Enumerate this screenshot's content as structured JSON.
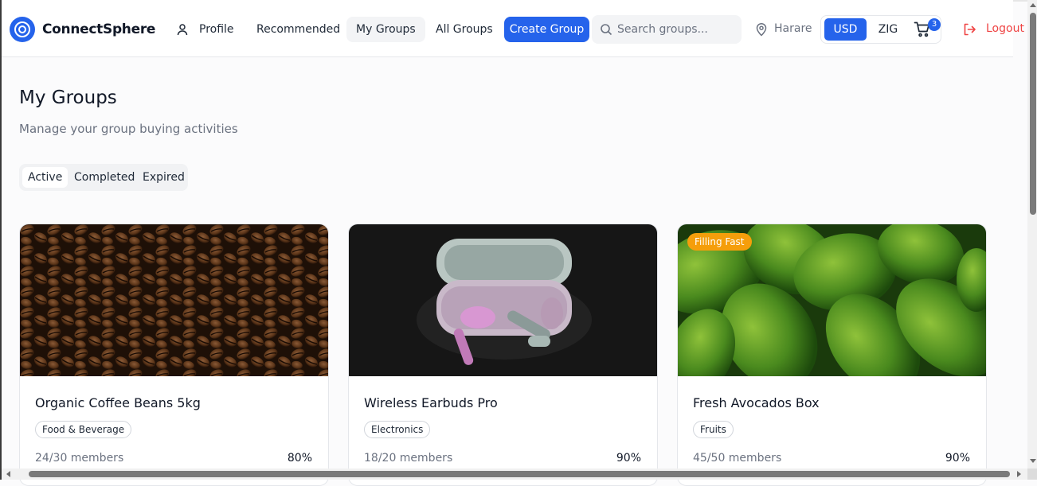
{
  "app": {
    "brand": "ConnectSphere"
  },
  "nav": {
    "profile": "Profile",
    "recommended": "Recommended",
    "my_groups": "My Groups",
    "all_groups": "All Groups",
    "create_group": "Create Group"
  },
  "search": {
    "placeholder": "Search groups..."
  },
  "location": {
    "city": "Harare"
  },
  "currency": {
    "options": [
      "USD",
      "ZIG"
    ],
    "selected": "USD"
  },
  "cart": {
    "count": "3"
  },
  "logout": "Logout",
  "page": {
    "title": "My Groups",
    "subtitle": "Manage your group buying activities",
    "tabs": [
      "Active",
      "Completed",
      "Expired"
    ],
    "active_tab": "Active"
  },
  "cards": [
    {
      "title": "Organic Coffee Beans 5kg",
      "category": "Food & Beverage",
      "members": "24/30 members",
      "percent": "80%",
      "badge": ""
    },
    {
      "title": "Wireless Earbuds Pro",
      "category": "Electronics",
      "members": "18/20 members",
      "percent": "90%",
      "badge": ""
    },
    {
      "title": "Fresh Avocados Box",
      "category": "Fruits",
      "members": "45/50 members",
      "percent": "90%",
      "badge": "Filling Fast"
    }
  ],
  "colors": {
    "primary": "#2563eb",
    "danger": "#ef4444",
    "badge_orange": "#f59e0b"
  }
}
